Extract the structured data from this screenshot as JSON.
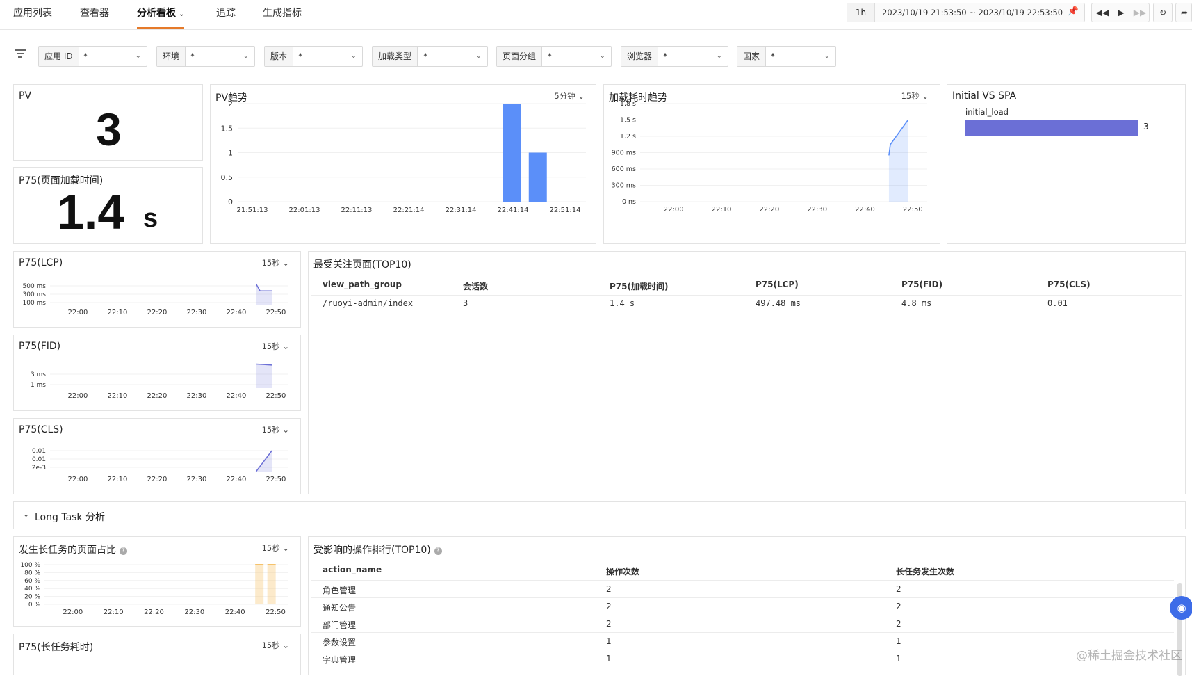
{
  "nav": {
    "tabs": [
      {
        "label": "应用列表"
      },
      {
        "label": "查看器"
      },
      {
        "label": "分析看板"
      },
      {
        "label": "追踪"
      },
      {
        "label": "生成指标"
      }
    ],
    "active_tab": "分析看板"
  },
  "time": {
    "range_button": "1h",
    "range_text": "2023/10/19 21:53:50 ~ 2023/10/19 22:53:50"
  },
  "filters": [
    {
      "label": "应用 ID",
      "value": "*"
    },
    {
      "label": "环境",
      "value": "*"
    },
    {
      "label": "版本",
      "value": "*"
    },
    {
      "label": "加载类型",
      "value": "*"
    },
    {
      "label": "页面分组",
      "value": "*"
    },
    {
      "label": "浏览器",
      "value": "*"
    },
    {
      "label": "国家",
      "value": "*"
    }
  ],
  "pv": {
    "title": "PV",
    "value": "3"
  },
  "p75_load": {
    "title": "P75(页面加载时间)",
    "value": "1.4",
    "unit": "s"
  },
  "pv_trend": {
    "title": "PV趋势",
    "interval": "5分钟"
  },
  "load_trend": {
    "title": "加载耗时趋势",
    "interval": "15秒"
  },
  "initial_spa": {
    "title": "Initial VS SPA",
    "bar_label": "initial_load",
    "bar_value_text": "3"
  },
  "lcp": {
    "title": "P75(LCP)",
    "interval": "15秒"
  },
  "fid": {
    "title": "P75(FID)",
    "interval": "15秒"
  },
  "cls": {
    "title": "P75(CLS)",
    "interval": "15秒"
  },
  "top_pages": {
    "title": "最受关注页面(TOP10)",
    "headers": [
      "view_path_group",
      "会话数",
      "P75(加载时间)",
      "P75(LCP)",
      "P75(FID)",
      "P75(CLS)"
    ],
    "rows": [
      [
        "/ruoyi-admin/index",
        "3",
        "1.4 s",
        "497.48 ms",
        "4.8 ms",
        "0.01"
      ]
    ]
  },
  "long_task": {
    "title": "Long Task 分析"
  },
  "longtask_ratio": {
    "title": "发生长任务的页面占比",
    "interval": "15秒"
  },
  "p75_longtask": {
    "title": "P75(长任务耗时)",
    "interval": "15秒"
  },
  "affected_actions": {
    "title": "受影响的操作排行(TOP10)",
    "headers": [
      "action_name",
      "操作次数",
      "长任务发生次数"
    ],
    "rows": [
      [
        "角色管理",
        "2",
        "2"
      ],
      [
        "通知公告",
        "2",
        "2"
      ],
      [
        "部门管理",
        "2",
        "2"
      ],
      [
        "参数设置",
        "1",
        "1"
      ],
      [
        "字典管理",
        "1",
        "1"
      ]
    ]
  },
  "watermark": "@稀土掘金技术社区",
  "colors": {
    "accent": "#e57a2a",
    "bar": "#5b8ff9",
    "line": "#6b6fd6",
    "longtask": "#f5c26b"
  },
  "chart_data": [
    {
      "type": "bar",
      "title": "PV趋势",
      "categories": [
        "21:51:13",
        "22:01:13",
        "22:11:13",
        "22:21:14",
        "22:31:14",
        "22:41:14",
        "22:51:14"
      ],
      "x": [
        "22:41",
        "22:46"
      ],
      "values": [
        2,
        1
      ],
      "yticks": [
        "0",
        "0.5",
        "1",
        "1.5",
        "2"
      ],
      "ylim": [
        0,
        2
      ]
    },
    {
      "type": "area",
      "title": "加载耗时趋势",
      "categories": [
        "22:00",
        "22:10",
        "22:20",
        "22:30",
        "22:40",
        "22:50"
      ],
      "yticks": [
        "0 ns",
        "300 ms",
        "600 ms",
        "900 ms",
        "1.2 s",
        "1.5 s",
        "1.8 s"
      ],
      "ylim_ms": [
        0,
        1800
      ],
      "points_ms": [
        [
          "22:45",
          850
        ],
        [
          "22:45",
          1050
        ],
        [
          "22:49",
          1500
        ]
      ]
    },
    {
      "type": "bar",
      "title": "Initial VS SPA",
      "categories": [
        "initial_load"
      ],
      "values": [
        3
      ]
    },
    {
      "type": "area",
      "title": "P75(LCP)",
      "categories": [
        "22:00",
        "22:10",
        "22:20",
        "22:30",
        "22:40",
        "22:50"
      ],
      "yticks": [
        "100 ms",
        "300 ms",
        "500 ms"
      ],
      "ylim_ms": [
        0,
        600
      ],
      "points_ms": [
        [
          "22:45",
          497
        ],
        [
          "22:46",
          330
        ],
        [
          "22:49",
          330
        ]
      ]
    },
    {
      "type": "area",
      "title": "P75(FID)",
      "categories": [
        "22:00",
        "22:10",
        "22:20",
        "22:30",
        "22:40",
        "22:50"
      ],
      "yticks": [
        "1 ms",
        "3 ms"
      ],
      "ylim_ms": [
        0,
        5
      ],
      "points_ms": [
        [
          "22:45",
          4.8
        ],
        [
          "22:49",
          4.6
        ]
      ]
    },
    {
      "type": "area",
      "title": "P75(CLS)",
      "categories": [
        "22:00",
        "22:10",
        "22:20",
        "22:30",
        "22:40",
        "22:50"
      ],
      "yticks": [
        "2e-3",
        "0.01",
        "0.01"
      ],
      "ylim": [
        0,
        0.012
      ],
      "points": [
        [
          "22:45",
          0.0
        ],
        [
          "22:49",
          0.01
        ]
      ]
    },
    {
      "type": "bar",
      "title": "发生长任务的页面占比",
      "categories": [
        "22:00",
        "22:10",
        "22:20",
        "22:30",
        "22:40",
        "22:50"
      ],
      "yticks": [
        "0 %",
        "20 %",
        "40 %",
        "60 %",
        "80 %",
        "100 %"
      ],
      "ylim": [
        0,
        100
      ],
      "values_pct": [
        [
          "22:46",
          100
        ],
        [
          "22:49",
          100
        ]
      ]
    }
  ]
}
